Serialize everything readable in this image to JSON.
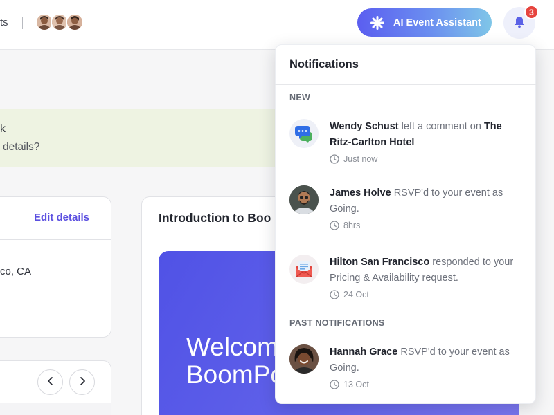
{
  "header": {
    "nav_fragment": "ts",
    "ai_button_label": "AI Event Assistant",
    "notification_count": "3"
  },
  "background": {
    "alert_title": "k",
    "alert_text": "details?",
    "edit_details": "Edit details",
    "location": "co, CA",
    "card_title": "Introduction to Boo",
    "hero_line1": "Welcom",
    "hero_line2": "BoomPo",
    "pager_prev": "‹",
    "pager_next": "›"
  },
  "notifications": {
    "title": "Notifications",
    "new_label": "NEW",
    "past_label": "PAST NOTIFICATIONS",
    "items": [
      {
        "actor": "Wendy Schust",
        "action": " left a comment on ",
        "target": "The Ritz-Carlton Hotel",
        "time": "Just now",
        "icon": "chat-bubble-icon"
      },
      {
        "actor": "James Holve",
        "action": " RSVP'd to your event as Going.",
        "target": "",
        "time": "8hrs",
        "icon": "avatar-photo"
      },
      {
        "actor": "Hilton San Francisco",
        "action": " responded to your Pricing & Availability request.",
        "target": "",
        "time": "24 Oct",
        "icon": "envelope-icon"
      },
      {
        "actor": "Hannah Grace",
        "action": " RSVP'd to your event as Going.",
        "target": "",
        "time": "13 Oct",
        "icon": "avatar-photo"
      }
    ]
  },
  "colors": {
    "accent": "#5b4fe0",
    "badge": "#e6443e",
    "alert_bg": "#eef3e2"
  }
}
